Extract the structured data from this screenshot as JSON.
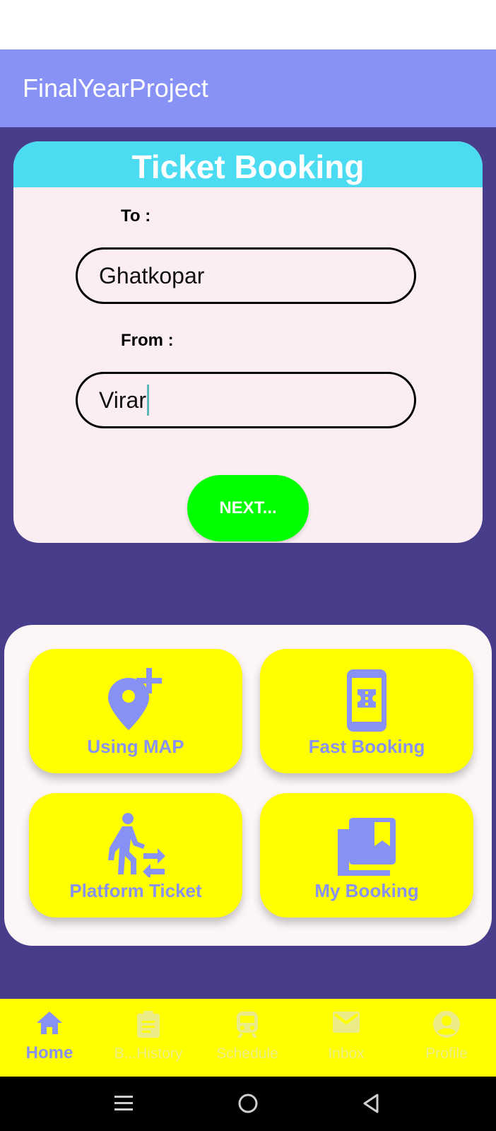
{
  "app": {
    "title": "FinalYearProject"
  },
  "booking": {
    "header": "Ticket Booking",
    "to_label": "To :",
    "to_value": "Ghatkopar",
    "from_label": "From :",
    "from_value": "Virar",
    "next_label": "NEXT..."
  },
  "options": [
    {
      "label": "Using MAP",
      "icon": "add-location-icon"
    },
    {
      "label": "Fast Booking",
      "icon": "phone-ticket-icon"
    },
    {
      "label": "Platform Ticket",
      "icon": "walk-transfer-icon"
    },
    {
      "label": "My Booking",
      "icon": "library-bookmark-icon"
    }
  ],
  "nav": [
    {
      "label": "Home",
      "icon": "home-icon",
      "active": true
    },
    {
      "label": "B...History",
      "icon": "clipboard-icon",
      "active": false
    },
    {
      "label": "Schedule",
      "icon": "train-icon",
      "active": false
    },
    {
      "label": "Inbox",
      "icon": "mail-icon",
      "active": false
    },
    {
      "label": "Profile",
      "icon": "account-circle-icon",
      "active": false
    }
  ],
  "colors": {
    "appbar": "#8891f5",
    "background": "#483d8b",
    "card_header": "#4cdcf2",
    "card": "#fcedf2",
    "next_button": "#00ff00",
    "tile": "#ffff00",
    "accent": "#8891f5"
  }
}
